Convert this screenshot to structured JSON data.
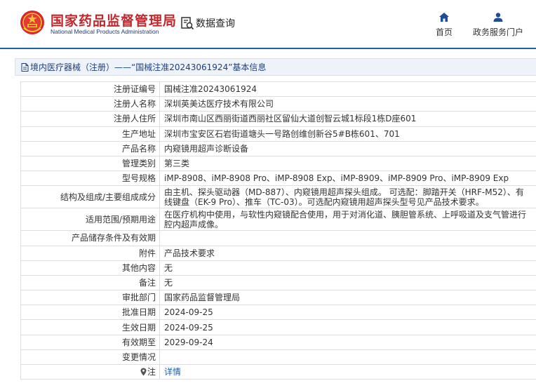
{
  "header": {
    "logo_cn": "国家药品监督管理局",
    "logo_en": "National Medical Products Administration",
    "query_label": "数据查询",
    "nav": [
      {
        "label": "首页",
        "icon": "home-icon"
      },
      {
        "label": "政务服务门户",
        "icon": "user-icon"
      }
    ],
    "colors": {
      "brand_red": "#c0282d",
      "brand_blue": "#1f5fae"
    }
  },
  "breadcrumb": {
    "text": "境内医疗器械（注册）——“国械注准20243061924”基本信息",
    "icon": "document-icon"
  },
  "detail_rows": [
    {
      "label": "注册证编号",
      "value": "国械注准20243061924"
    },
    {
      "label": "注册人名称",
      "value": "深圳英美达医疗技术有限公司"
    },
    {
      "label": "注册人住所",
      "value": "深圳市南山区西丽街道西丽社区留仙大道创智云城1标段1栋D座601"
    },
    {
      "label": "生产地址",
      "value": "深圳市宝安区石岩街道塘头一号路创维创新谷5#B栋601、701"
    },
    {
      "label": "产品名称",
      "value": "内窥镜用超声诊断设备"
    },
    {
      "label": "管理类别",
      "value": "第三类"
    },
    {
      "label": "型号规格",
      "value": "iMP-8908、iMP-8908 Pro、iMP-8908 Exp、iMP-8909、iMP-8909 Pro、iMP-8909 Exp"
    },
    {
      "label": "结构及组成/主要组成成分",
      "value": "由主机、探头驱动器（MD-887）、内窥镜用超声探头组成。 可选配：脚踏开关（HRF-M52）、有线键盘（EK-9 Pro）、推车（TC-03）。可选配内窥镜用超声探头型号见产品技术要求。"
    },
    {
      "label": "适用范围/预期用途",
      "value": "在医疗机构中使用，与软性内窥镜配合使用，用于对消化道、胰胆管系统、上呼吸道及支气管进行腔内超声成像。"
    },
    {
      "label": "产品储存条件及有效期",
      "value": ""
    },
    {
      "label": "附件",
      "value": "产品技术要求"
    },
    {
      "label": "其他内容",
      "value": "无"
    },
    {
      "label": "备注",
      "value": "无"
    },
    {
      "label": "审批部门",
      "value": "国家药品监督管理局"
    },
    {
      "label": "批准日期",
      "value": "2024-09-25"
    },
    {
      "label": "生效日期",
      "value": "2024-09-25"
    },
    {
      "label": "有效期至",
      "value": "2029-09-24"
    },
    {
      "label": "变更情况",
      "value": ""
    },
    {
      "label": "注",
      "value": "详情",
      "icon": "location-pin-icon"
    }
  ]
}
